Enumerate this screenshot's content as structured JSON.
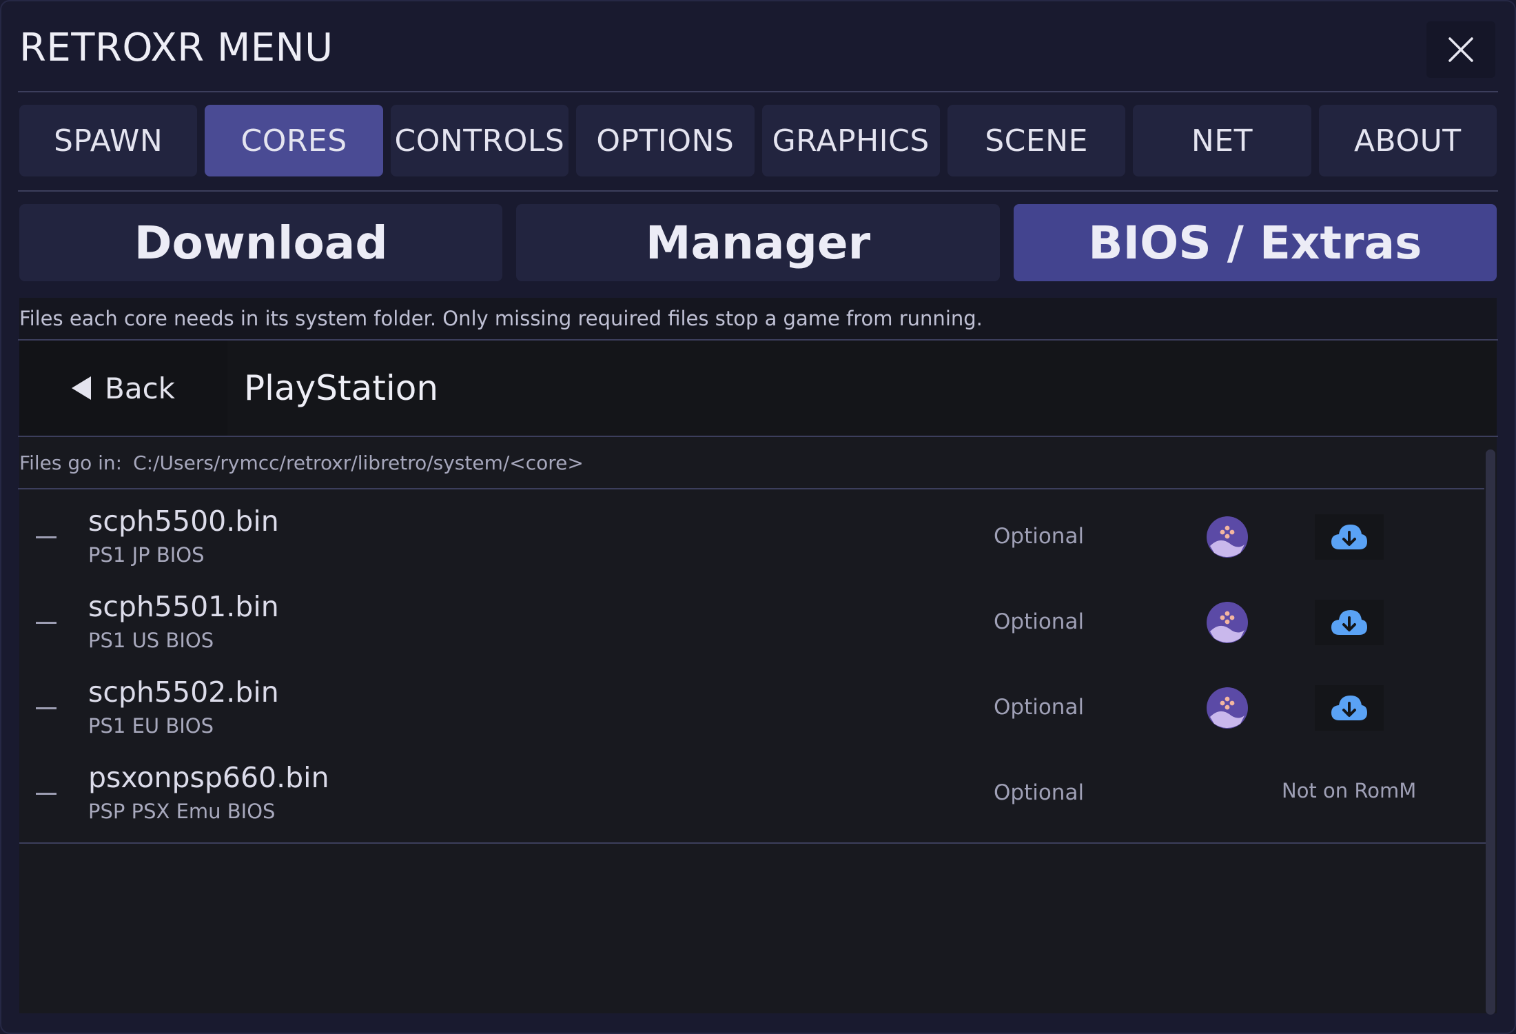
{
  "app": {
    "title": "RETROXR MENU"
  },
  "tabs": [
    {
      "label": "SPAWN",
      "active": false
    },
    {
      "label": "CORES",
      "active": true
    },
    {
      "label": "CONTROLS",
      "active": false
    },
    {
      "label": "OPTIONS",
      "active": false
    },
    {
      "label": "GRAPHICS",
      "active": false
    },
    {
      "label": "SCENE",
      "active": false
    },
    {
      "label": "NET",
      "active": false
    },
    {
      "label": "ABOUT",
      "active": false
    }
  ],
  "subtabs": [
    {
      "label": "Download",
      "active": false
    },
    {
      "label": "Manager",
      "active": false
    },
    {
      "label": "BIOS / Extras",
      "active": true
    }
  ],
  "info": "Files each core needs in its system folder. Only missing required files stop a game from running.",
  "header": {
    "back_label": "Back",
    "console": "PlayStation"
  },
  "path": {
    "label": "Files go in:",
    "value": "C:/Users/rymcc/retroxr/libretro/system/<core>"
  },
  "files": [
    {
      "name": "scph5500.bin",
      "desc": "PS1 JP BIOS",
      "status": "Optional",
      "note": ""
    },
    {
      "name": "scph5501.bin",
      "desc": "PS1 US BIOS",
      "status": "Optional",
      "note": ""
    },
    {
      "name": "scph5502.bin",
      "desc": "PS1 EU BIOS",
      "status": "Optional",
      "note": ""
    },
    {
      "name": "psxonpsp660.bin",
      "desc": "PSP PSX Emu BIOS",
      "status": "Optional",
      "note": "Not on RomM"
    }
  ],
  "icons": {
    "close": "close-icon",
    "back": "back-arrow-icon",
    "romm": "romm-logo-icon",
    "download": "cloud-download-icon",
    "status_marker": "dash-icon"
  },
  "colors": {
    "background": "#191a2f",
    "tab": "#22243f",
    "tab_active": "#4a4b94",
    "download_blue": "#5aa2f5",
    "romm_purple": "#5b4aa6"
  }
}
